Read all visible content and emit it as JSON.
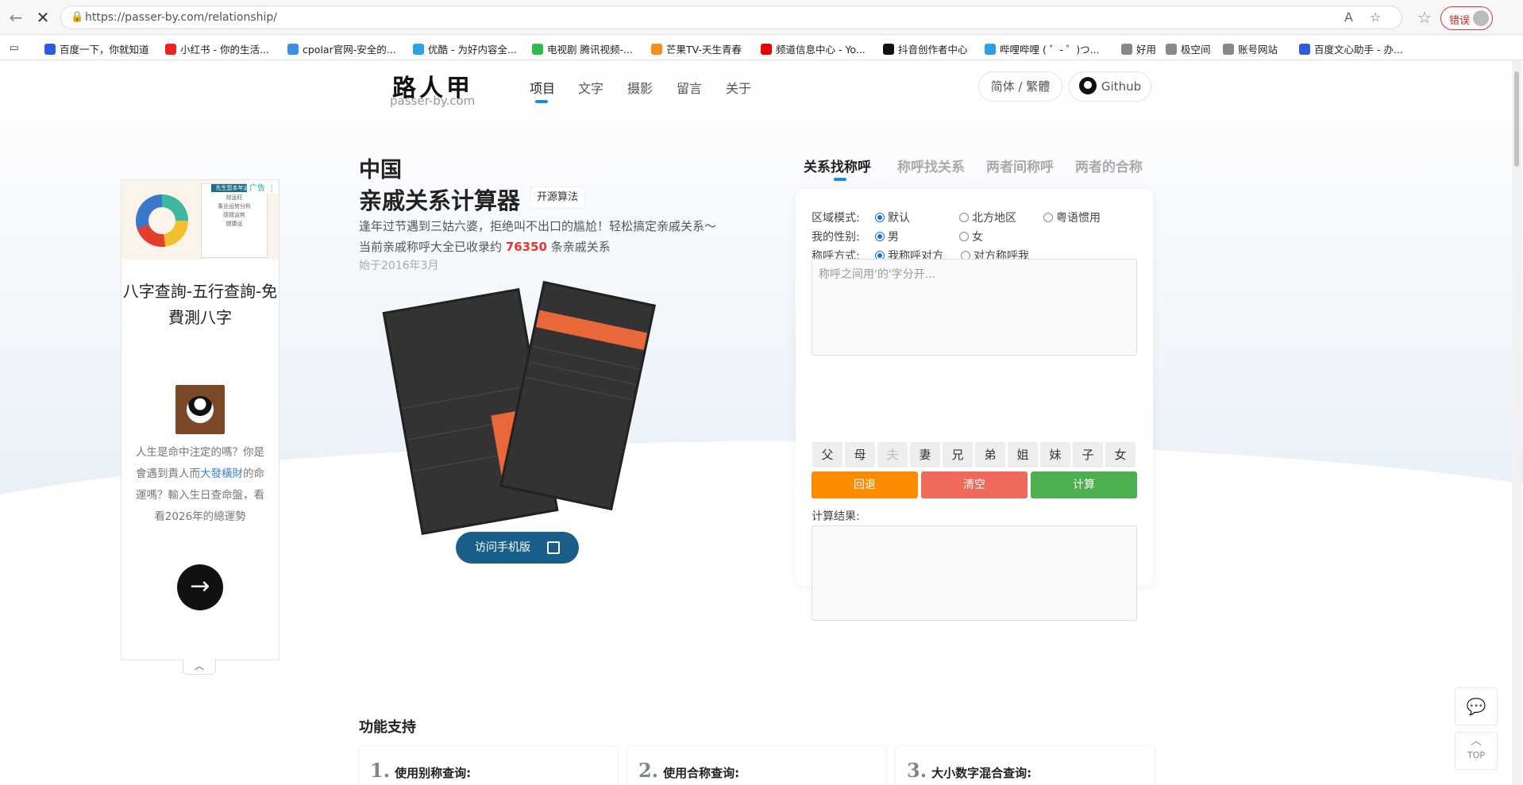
{
  "browser": {
    "url": "https://passer-by.com/relationship/",
    "error_label": "错误"
  },
  "bookmarks": [
    {
      "label": "百度一下，你就知道",
      "color": "#2f5be0"
    },
    {
      "label": "小红书 - 你的生活...",
      "color": "#e22"
    },
    {
      "label": "cpolar官网-安全的...",
      "color": "#3a8ee6"
    },
    {
      "label": "优酷 - 为好内容全...",
      "color": "#2aa3e8"
    },
    {
      "label": "电视剧 腾讯视频-...",
      "color": "#2bbb4f"
    },
    {
      "label": "芒果TV-天生青春",
      "color": "#f68b1f"
    },
    {
      "label": "频道信息中心 - Yo...",
      "color": "#e00"
    },
    {
      "label": "抖音创作者中心",
      "color": "#111"
    },
    {
      "label": "哔哩哔哩 ( ゜- ゜)つ...",
      "color": "#2aa1e6"
    },
    {
      "label": "好用",
      "color": "#888"
    },
    {
      "label": "极空间",
      "color": "#888"
    },
    {
      "label": "账号网站",
      "color": "#888"
    },
    {
      "label": "百度文心助手 - 办...",
      "color": "#2f5be0"
    }
  ],
  "site": {
    "logo_cn": "路人甲",
    "logo_en": "passer-by.com",
    "nav": [
      "项目",
      "文字",
      "摄影",
      "留言",
      "关于"
    ],
    "lang_label": "简体 / 繁體",
    "github_label": "Github"
  },
  "ad": {
    "tag": "广告",
    "card_title": "先生您本年运势",
    "card_lines": [
      "财运旺",
      "事业运势分析",
      "感情运势",
      "健康运"
    ],
    "title": "八字查詢-五行查詢-免費測八字",
    "text_before": "人生是命中注定的嗎？你是會遇到貴人而",
    "text_highlight": "大發橫財",
    "text_after": "的命運嗎？輸入生日查命盤，看看2026年的總運勢"
  },
  "hero": {
    "title_line1": "中国",
    "title_line2": "亲戚关系计算器",
    "badge": "开源算法",
    "desc_line1": "逢年过节遇到三姑六婆，拒绝叫不出口的尴尬！轻松搞定亲戚关系～",
    "desc_pre": "当前亲戚称呼大全已收录约 ",
    "desc_count": "76350",
    "desc_post": " 条亲戚关系",
    "since": "始于2016年3月",
    "mobile_btn": "访问手机版"
  },
  "tabs": [
    "关系找称呼",
    "称呼找关系",
    "两者间称呼",
    "两者的合称"
  ],
  "form": {
    "region_label": "区域模式:",
    "region_options": [
      "默认",
      "北方地区",
      "粤语惯用"
    ],
    "gender_label": "我的性别:",
    "gender_options": [
      "男",
      "女"
    ],
    "call_label": "称呼方式:",
    "call_options": [
      "我称呼对方",
      "对方称呼我"
    ],
    "input_placeholder": "称呼之间用'的'字分开...",
    "keys": [
      "父",
      "母",
      "夫",
      "妻",
      "兄",
      "弟",
      "姐",
      "妹",
      "子",
      "女"
    ],
    "back": "回退",
    "clear": "清空",
    "calc": "计算",
    "result_label": "计算结果:"
  },
  "features": {
    "title": "功能支持",
    "items": [
      {
        "num": "1.",
        "label": "使用别称查询:"
      },
      {
        "num": "2.",
        "label": "使用合称查询:"
      },
      {
        "num": "3.",
        "label": "大小数字混合查询:"
      }
    ]
  },
  "float": {
    "top_label": "TOP"
  },
  "colors": {
    "accent": "#1e88e5",
    "back": "#fb8c00",
    "clear": "#ef6a5a",
    "calc": "#4caf50"
  }
}
